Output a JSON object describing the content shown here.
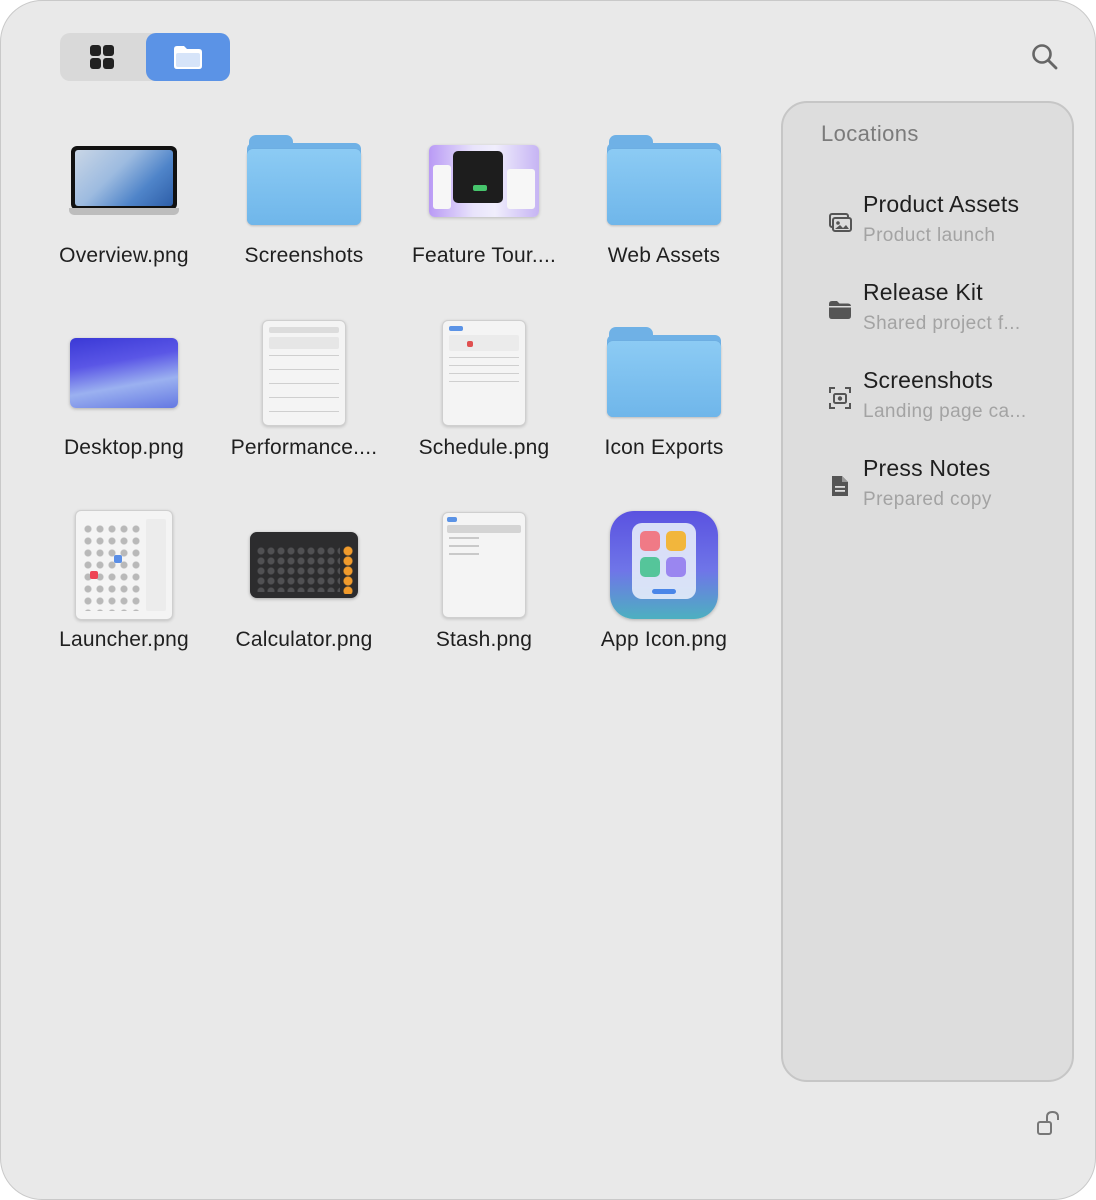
{
  "toolbar": {
    "views": [
      {
        "icon": "grid-icon",
        "selected": false
      },
      {
        "icon": "folder-icon",
        "selected": true
      }
    ],
    "search_icon": "search-icon",
    "accent_color": "#5b93e6"
  },
  "files": [
    {
      "name": "Overview.png",
      "kind": "image"
    },
    {
      "name": "Screenshots",
      "kind": "folder"
    },
    {
      "name": "Feature Tour....",
      "kind": "image"
    },
    {
      "name": "Web Assets",
      "kind": "folder"
    },
    {
      "name": "Desktop.png",
      "kind": "image"
    },
    {
      "name": "Performance....",
      "kind": "image"
    },
    {
      "name": "Schedule.png",
      "kind": "image"
    },
    {
      "name": "Icon Exports",
      "kind": "folder"
    },
    {
      "name": "Launcher.png",
      "kind": "image"
    },
    {
      "name": "Calculator.png",
      "kind": "image"
    },
    {
      "name": "Stash.png",
      "kind": "image"
    },
    {
      "name": "App Icon.png",
      "kind": "image"
    }
  ],
  "sidebar": {
    "title": "Locations",
    "items": [
      {
        "title": "Product Assets",
        "subtitle": "Product launch",
        "icon": "photos-icon"
      },
      {
        "title": "Release Kit",
        "subtitle": "Shared project f...",
        "icon": "folder-icon"
      },
      {
        "title": "Screenshots",
        "subtitle": "Landing page ca...",
        "icon": "screenshot-icon"
      },
      {
        "title": "Press Notes",
        "subtitle": "Prepared copy",
        "icon": "document-icon"
      }
    ]
  },
  "footer": {
    "lock_icon": "unlock-icon"
  }
}
